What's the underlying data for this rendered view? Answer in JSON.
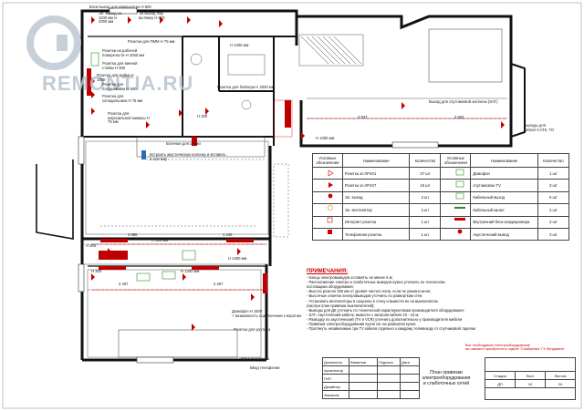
{
  "logo": {
    "name": "REMONTIA.RU"
  },
  "room_labels": [
    "Блок выход для компьютера Н 600",
    "Эл. выход на 1100 мм Н 2000 мм",
    "Эл.выход под вытяжку Н 600",
    "Розетки для ПММ Н 75 мм",
    "Розетки на рабочей поверхности Н 1050 мм",
    "Розетка для винной стойки Н 300",
    "Розетка для мойки Н 1000",
    "Розетка для посудомойки Н 600",
    "Розетка для холодильника Н 75 мм",
    "Розетка для морозильной камеры Н 75 мм",
    "Н 1300 мм",
    "Розетка для бойлера Н 2000 мм",
    "Н 300",
    "3 937",
    "3 583",
    "Н 1300 мм",
    "Выход для спутниковой антенны (SAT)",
    "Выходы для кабеля CAT6, ТО",
    "Блочная для сушки",
    "Встроить акустическую колонку и вставить в систему",
    "Н 400",
    "2 888",
    "1 445",
    "Н 300 мм",
    "Н 1300 мм",
    "2 257",
    "2 257",
    "Н 1300 мм",
    "Н 300",
    "Домофон Н 1500",
    "+ возможность подключения к воротам",
    "Розетка для роутера",
    "Ввод интернета",
    "Ввод телефонии"
  ],
  "legend": {
    "headers": [
      "Условные обозначения",
      "Наименование",
      "Количество",
      "Условные обозначения",
      "Наименование",
      "Количество"
    ],
    "rows": [
      {
        "icon_left": "socket-triangle-icon",
        "name_left": "Розетка эл./IP4X1",
        "qty_left": "37 шт",
        "icon_right": "intercom-icon",
        "name_right": "Домофон",
        "qty_right": "1 шт"
      },
      {
        "icon_left": "socket-double-triangle-icon",
        "name_left": "Розетка эл./IP4X7",
        "qty_left": "18 шт",
        "icon_right": "satellite-tv-icon",
        "name_right": "спутниковое TV",
        "qty_right": "3 шт"
      },
      {
        "icon_left": "electric-output-icon",
        "name_left": "Эл. выход",
        "qty_left": "2 шт",
        "icon_right": "cable-output-icon",
        "name_right": "Кабельный выход",
        "qty_right": "6 шт"
      },
      {
        "icon_left": "fan-icon",
        "name_left": "Эл. вентилятор",
        "qty_left": "2 шт",
        "icon_right": "cable-channel-icon",
        "name_right": "Кабельный канал",
        "qty_right": "2 шт"
      },
      {
        "icon_left": "internet-socket-icon",
        "name_left": "Интернет розетка",
        "qty_left": "1 шт",
        "icon_right": "ac-unit-icon",
        "name_right": "Внутренний блок кондиционера",
        "qty_right": "3 шт"
      },
      {
        "icon_left": "phone-socket-icon",
        "name_left": "Телефонная розетка",
        "qty_left": "1 шт",
        "icon_right": "speaker-output-icon",
        "name_right": "Акустический вывод",
        "qty_right": "3 шт"
      }
    ]
  },
  "notes": {
    "title": "ПРИМЕЧАНИЯ:",
    "lines": [
      "- Концы электровыводов оставлять не менее 5 м;",
      "- Расположение электро и слаботочных выводов нужно уточнить по технологии",
      "  поставщика оборудования;",
      "- Высота розеток 250 мм от уровня чистого пола, если не указано иное;",
      "- Высотные отметки электровыводов уточнить по разверткам стен;",
      "- Установить вентиляторы в санузлах в стену и вывести их на выключатель",
      "  (смотри план привязки выключателей);",
      "- Выводы для ДК уточнить по технической характеристикам производителя оборудования;",
      "- SAT, Акустический кабель: вывести с запасом кабеля 10 - 15 м;",
      "- Разводку по акустический (TV и  VCR) уточнить дополнительно у производителя мебели",
      "- Привязки электрооборудования кухни см. на развертки кухни",
      "- Протянуть независимые три TV кабеля отдельно к каждому телевизору от спутниковой тарелки"
    ]
  },
  "warning": {
    "lines": [
      "Все необходимое электрооборудование",
      "вы сможете приобрести в отделе \"Снабжения\" ГК Фундамент"
    ]
  },
  "title_block": {
    "rows": [
      {
        "role": "Должность",
        "surname": "Фамилия",
        "signature": "Подпись",
        "date": "Дата"
      },
      {
        "role": "Архитектор",
        "surname": "",
        "signature": "",
        "date": ""
      },
      {
        "role": "ГИП",
        "surname": "",
        "signature": "",
        "date": ""
      },
      {
        "role": "Дизайнер",
        "surname": "",
        "signature": "",
        "date": ""
      },
      {
        "role": "Заказчик",
        "surname": "",
        "signature": "",
        "date": ""
      }
    ],
    "title": "План привязки электрооборудования и слаботочных сетей",
    "stage_label": "Стадия",
    "sheet_label": "Лист",
    "sheets_label": "Листов",
    "stage": "ДП",
    "sheet": "10",
    "sheets": "24"
  },
  "colors": {
    "wall": "#111111",
    "accent": "#c00000",
    "socket": "#c00000",
    "blue_logo": "#9fb3c6",
    "cable_green": "#2a8a2a"
  }
}
